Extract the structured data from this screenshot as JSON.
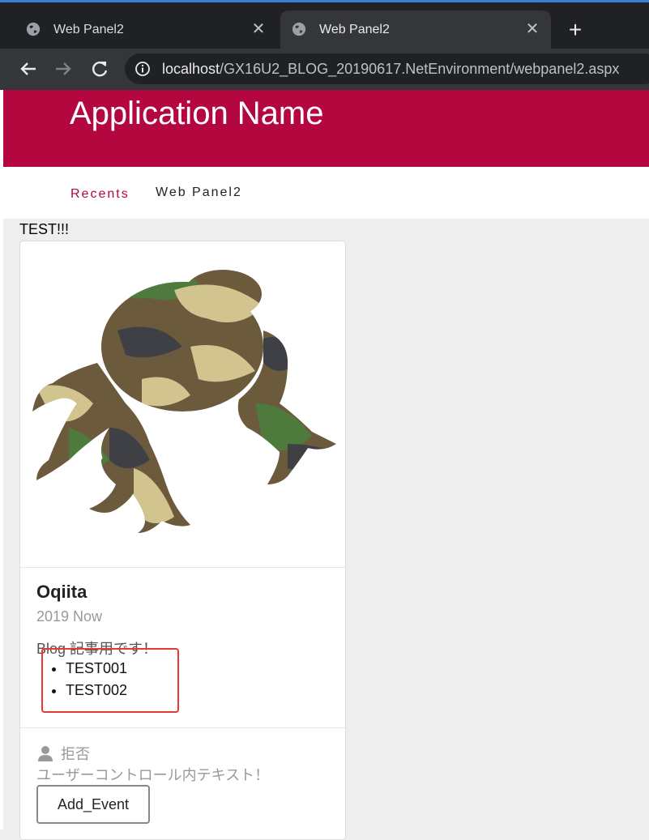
{
  "browser": {
    "tabs": [
      {
        "title": "Web Panel2",
        "active": false
      },
      {
        "title": "Web Panel2",
        "active": true
      }
    ],
    "url_host": "localhost",
    "url_path": "/GX16U2_BLOG_20190617.NetEnvironment/webpanel2.aspx"
  },
  "header": {
    "app_name": "Application Name",
    "color": "#b5073f"
  },
  "nav": {
    "recents": "Recents",
    "current": "Web Panel2"
  },
  "page": {
    "test_text": "TEST!!!"
  },
  "card": {
    "title": "Oqiita",
    "subtitle": "2019 Now",
    "description": "Blog 記事用です！",
    "items": [
      "TEST001",
      "TEST002"
    ],
    "user_label": "拒否",
    "control_text": "ユーザーコントロール内テキスト！",
    "button_label": "Add_Event"
  }
}
